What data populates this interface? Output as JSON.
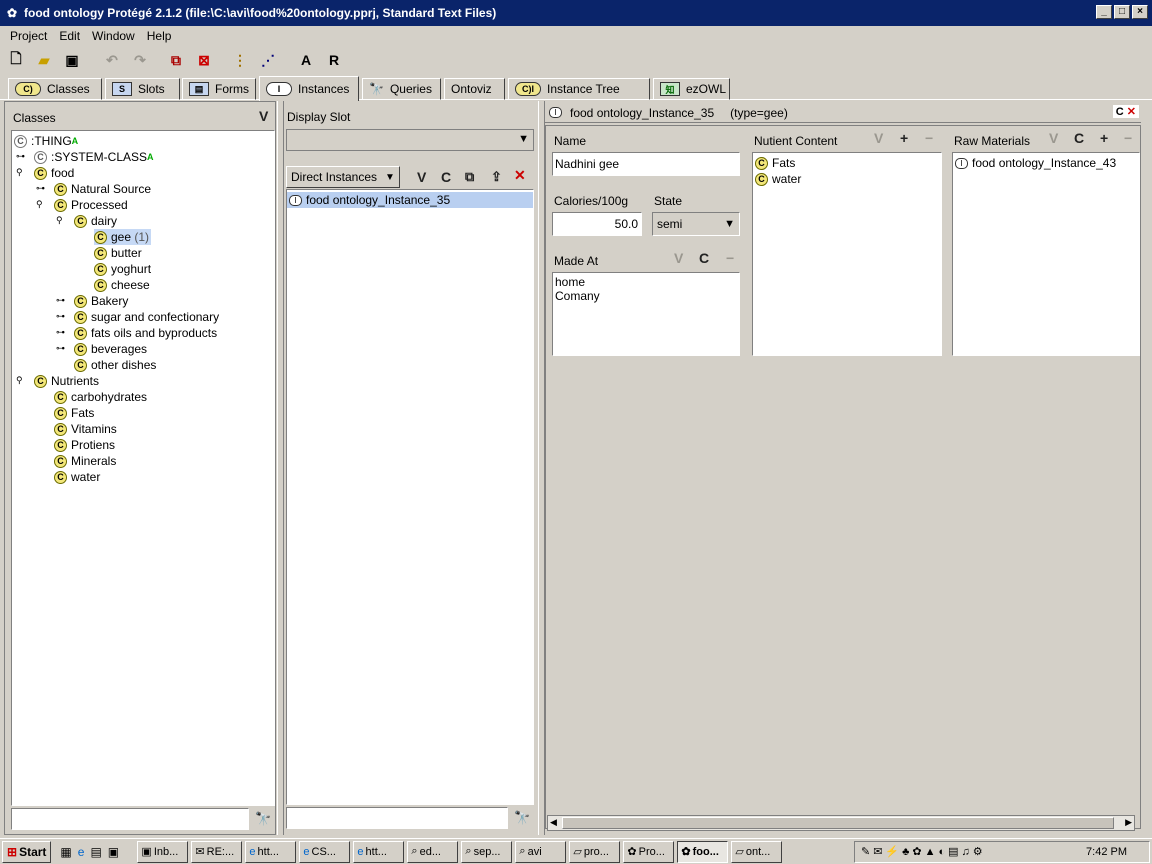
{
  "window": {
    "title": "food ontology  Protégé 2.1.2    (file:\\C:\\avi\\food%20ontology.pprj, Standard Text Files)"
  },
  "menu": [
    "Project",
    "Edit",
    "Window",
    "Help"
  ],
  "tabs": [
    {
      "label": "Classes",
      "icon": "C"
    },
    {
      "label": "Slots",
      "icon": "S"
    },
    {
      "label": "Forms",
      "icon": "F"
    },
    {
      "label": "Instances",
      "icon": "I"
    },
    {
      "label": "Queries",
      "icon": "binoculars"
    },
    {
      "label": "Ontoviz",
      "icon": ""
    },
    {
      "label": "Instance Tree",
      "icon": "CI"
    },
    {
      "label": "ezOWL",
      "icon": "知"
    }
  ],
  "classes_panel": {
    "title": "Classes",
    "v_button": "V",
    "tree": [
      {
        "label": ":THING",
        "badge": "A"
      },
      {
        "label": ":SYSTEM-CLASS",
        "badge": "A"
      },
      {
        "label": "food"
      },
      {
        "label": "Natural Source"
      },
      {
        "label": "Processed"
      },
      {
        "label": "dairy"
      },
      {
        "label": "gee",
        "count": "(1)"
      },
      {
        "label": "butter"
      },
      {
        "label": "yoghurt"
      },
      {
        "label": "cheese"
      },
      {
        "label": "Bakery"
      },
      {
        "label": "sugar and confectionary"
      },
      {
        "label": "fats oils and byproducts"
      },
      {
        "label": "beverages"
      },
      {
        "label": "other dishes"
      },
      {
        "label": "Nutrients"
      },
      {
        "label": "carbohydrates"
      },
      {
        "label": "Fats"
      },
      {
        "label": "Vitamins"
      },
      {
        "label": "Protiens"
      },
      {
        "label": "Minerals"
      },
      {
        "label": "water"
      }
    ]
  },
  "instances_panel": {
    "display_slot_label": "Display Slot",
    "direct_instances": "Direct Instances",
    "buttons": {
      "v": "V",
      "c": "C"
    },
    "instances": [
      "food ontology_Instance_35"
    ]
  },
  "form": {
    "header": "food ontology_Instance_35",
    "type": "(type=gee)",
    "header_c": "C",
    "name_label": "Name",
    "name_value": "Nadhini gee",
    "calories_label": "Calories/100g",
    "calories_value": "50.0",
    "state_label": "State",
    "state_value": "semi",
    "made_at_label": "Made At",
    "made_at_values": [
      "home",
      "Comany"
    ],
    "nutrient_label": "Nutient Content",
    "nutrient_values": [
      "Fats",
      "water"
    ],
    "raw_label": "Raw Materials",
    "raw_values": [
      "food ontology_Instance_43"
    ],
    "btn_v": "V",
    "btn_c": "C",
    "btn_plus": "+",
    "btn_minus": "−"
  },
  "taskbar": {
    "start": "Start",
    "tasks": [
      "Inb...",
      "RE:...",
      "htt...",
      "CS...",
      "htt...",
      "ed...",
      "sep...",
      "avi",
      "pro...",
      "Pro...",
      "foo...",
      "ont..."
    ],
    "clock": "7:42 PM"
  }
}
